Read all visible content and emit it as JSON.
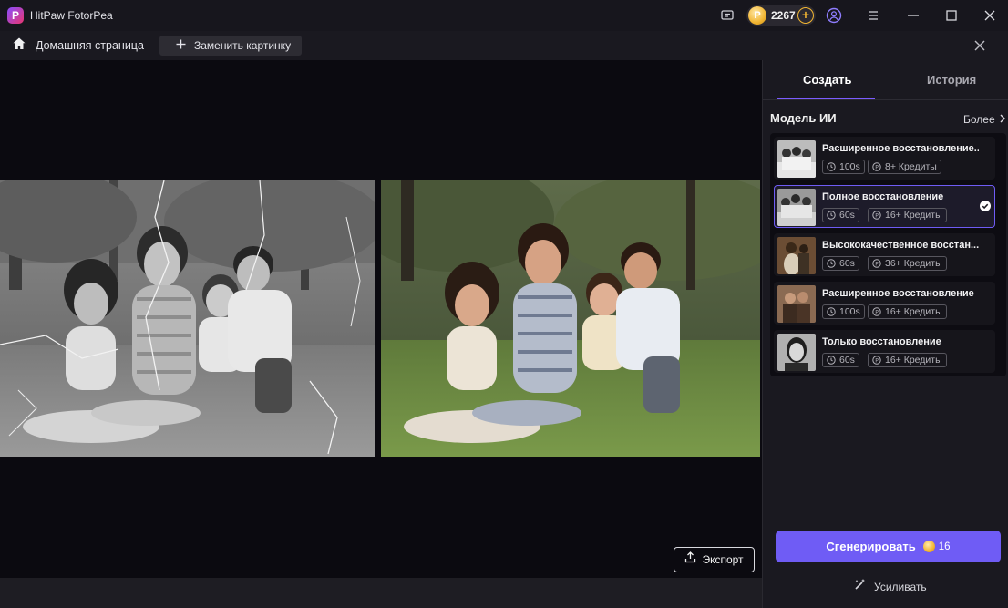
{
  "app": {
    "title": "HitPaw FotorPea",
    "logo_letter": "P",
    "credits": "2267",
    "icons": [
      "feedback-icon",
      "user-icon",
      "menu-icon",
      "minimize-icon",
      "maximize-icon",
      "window-close-icon"
    ]
  },
  "toolbar": {
    "home_label": "Домашняя страница",
    "replace_label": "Заменить картинку"
  },
  "canvas": {
    "export_label": "Экспорт"
  },
  "panel": {
    "tabs": [
      {
        "label": "Создать",
        "active": true
      },
      {
        "label": "История",
        "active": false
      }
    ],
    "section_title": "Модель ИИ",
    "more_label": "Более",
    "models": [
      {
        "name": "Расширенное восстановление...",
        "time": "100s",
        "credits": "8+ Кредиты",
        "selected": false
      },
      {
        "name": "Полное восстановление",
        "time": "60s",
        "credits": "16+ Кредиты",
        "selected": true
      },
      {
        "name": "Высококачественное восстан...",
        "time": "60s",
        "credits": "36+ Кредиты",
        "selected": false
      },
      {
        "name": "Расширенное восстановление",
        "time": "100s",
        "credits": "16+ Кредиты",
        "selected": false
      },
      {
        "name": "Только восстановление",
        "time": "60s",
        "credits": "16+ Кредиты",
        "selected": false
      }
    ],
    "generate_label": "Сгенерировать",
    "generate_cost": "16",
    "enhance_label": "Усиливать"
  },
  "colors": {
    "accent": "#6f5cf5",
    "coin": "#f1b532",
    "background": "#0b0a10",
    "panel": "#1a1920"
  }
}
